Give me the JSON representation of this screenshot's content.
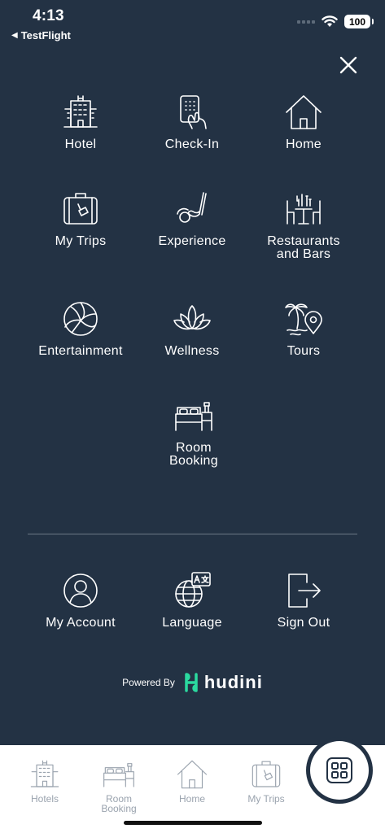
{
  "status_bar": {
    "time": "4:13",
    "back_app": "TestFlight",
    "battery": "100"
  },
  "menu": {
    "items": [
      {
        "label": "Hotel",
        "icon": "hotel-building-icon"
      },
      {
        "label": "Check-In",
        "icon": "phone-tap-icon"
      },
      {
        "label": "Home",
        "icon": "house-icon"
      },
      {
        "label": "My Trips",
        "icon": "suitcase-icon"
      },
      {
        "label": "Experience",
        "icon": "golf-club-icon"
      },
      {
        "label": "Restaurants\nand Bars",
        "icon": "dining-table-icon"
      },
      {
        "label": "Entertainment",
        "icon": "volleyball-icon"
      },
      {
        "label": "Wellness",
        "icon": "lotus-icon"
      },
      {
        "label": "Tours",
        "icon": "palm-pin-icon"
      },
      {
        "label": "Room\nBooking",
        "icon": "bed-icon"
      }
    ]
  },
  "account": {
    "items": [
      {
        "label": "My Account",
        "icon": "user-icon"
      },
      {
        "label": "Language",
        "icon": "globe-translate-icon"
      },
      {
        "label": "Sign Out",
        "icon": "sign-out-icon"
      }
    ]
  },
  "footer": {
    "powered_by": "Powered By",
    "brand": "hudini",
    "brand_color": "#2bd99f"
  },
  "bottom_nav": {
    "items": [
      {
        "label": "Hotels"
      },
      {
        "label": "Room\nBooking"
      },
      {
        "label": "Home"
      },
      {
        "label": "My Trips"
      }
    ]
  },
  "colors": {
    "background": "#233244",
    "nav_inactive": "#9aa3ae"
  }
}
